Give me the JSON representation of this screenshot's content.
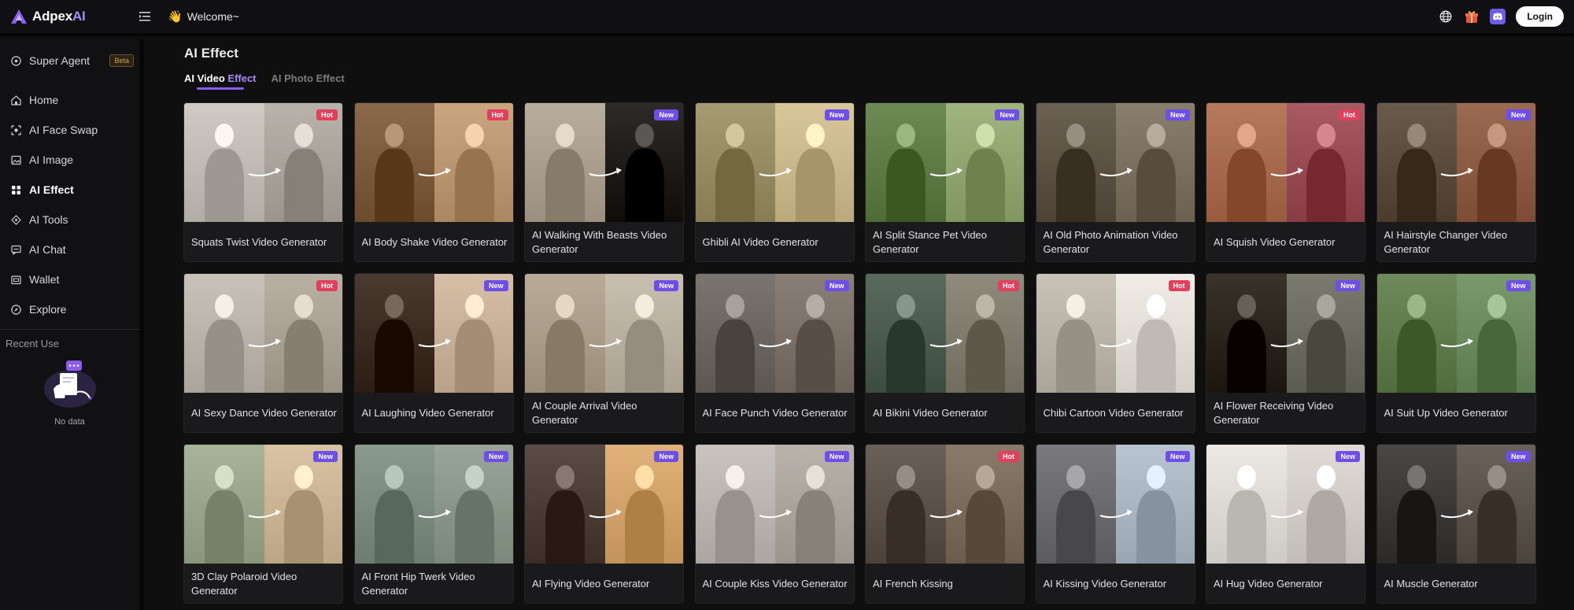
{
  "header": {
    "logo_prefix": "Adpex",
    "logo_suffix": "AI",
    "welcome_emoji": "👋",
    "welcome": "Welcome~",
    "login_label": "Login"
  },
  "sidebar": {
    "items": [
      {
        "label": "Super Agent",
        "icon": "agent-icon",
        "badge": "Beta",
        "active": false
      },
      {
        "label": "Home",
        "icon": "home-icon",
        "active": false
      },
      {
        "label": "AI Face Swap",
        "icon": "face-swap-icon",
        "active": false
      },
      {
        "label": "AI Image",
        "icon": "image-icon",
        "active": false
      },
      {
        "label": "AI Effect",
        "icon": "effect-icon",
        "active": true
      },
      {
        "label": "AI Tools",
        "icon": "tools-icon",
        "active": false
      },
      {
        "label": "AI Chat",
        "icon": "chat-icon",
        "active": false
      },
      {
        "label": "Wallet",
        "icon": "wallet-icon",
        "active": false
      },
      {
        "label": "Explore",
        "icon": "explore-icon",
        "active": false
      }
    ],
    "recent_title": "Recent Use",
    "empty_text": "No data"
  },
  "main": {
    "title": "AI Effect",
    "tabs": [
      {
        "prefix": "AI Video",
        "highlight": " Effect",
        "active": true
      },
      {
        "prefix": "AI Photo Effect",
        "highlight": "",
        "active": false
      }
    ]
  },
  "cards": [
    {
      "title": "Squats Twist Video Generator",
      "badge": "Hot",
      "colors": [
        "#cfcac4",
        "#b8b2ab"
      ]
    },
    {
      "title": "AI Body Shake Video Generator",
      "badge": "Hot",
      "colors": [
        "#8a6a4a",
        "#c9a680"
      ]
    },
    {
      "title": "AI Walking With Beasts Video Generator",
      "badge": "New",
      "colors": [
        "#b9ad9c",
        "#2d2a28"
      ]
    },
    {
      "title": "Ghibli AI Video Generator",
      "badge": "New",
      "colors": [
        "#a69a72",
        "#d8c79a"
      ]
    },
    {
      "title": "AI Split Stance Pet Video Generator",
      "badge": "New",
      "colors": [
        "#6d8a55",
        "#9fb47e"
      ]
    },
    {
      "title": "AI Old Photo Animation Video Generator",
      "badge": "New",
      "colors": [
        "#6b6152",
        "#8a7f6d"
      ]
    },
    {
      "title": "AI Squish Video Generator",
      "badge": "Hot",
      "colors": [
        "#b6795e",
        "#a85a62"
      ]
    },
    {
      "title": "AI Hairstyle Changer Video Generator",
      "badge": "New",
      "colors": [
        "#6a5a4c",
        "#9a6a52"
      ]
    },
    {
      "title": "AI Sexy Dance Video Generator",
      "badge": "Hot",
      "colors": [
        "#c8c2b9",
        "#b9b0a4"
      ]
    },
    {
      "title": "AI Laughing Video Generator",
      "badge": "New",
      "colors": [
        "#4a3a30",
        "#d6bfa6"
      ]
    },
    {
      "title": "AI Couple Arrival Video Generator",
      "badge": "New",
      "colors": [
        "#b9ab98",
        "#c9bfb0"
      ]
    },
    {
      "title": "AI Face Punch Video Generator",
      "badge": "New",
      "colors": [
        "#7a7570",
        "#8a8078"
      ]
    },
    {
      "title": "AI Bikini Video Generator",
      "badge": "Hot",
      "colors": [
        "#5a6a5c",
        "#8e8a7c"
      ]
    },
    {
      "title": "Chibi Cartoon Video Generator",
      "badge": "Hot",
      "colors": [
        "#c9c2b6",
        "#f1ece6"
      ]
    },
    {
      "title": "AI Flower Receiving Video Generator",
      "badge": "New",
      "colors": [
        "#3a332c",
        "#7a7a6e"
      ]
    },
    {
      "title": "AI Suit Up Video Generator",
      "badge": "New",
      "colors": [
        "#6f8a5a",
        "#7a9a6e"
      ]
    },
    {
      "title": "3D Clay Polaroid Video Generator",
      "badge": "New",
      "colors": [
        "#a8b49a",
        "#d9c3a3"
      ]
    },
    {
      "title": "AI Front Hip Twerk Video Generator",
      "badge": "New",
      "colors": [
        "#8a9a8c",
        "#98a598"
      ]
    },
    {
      "title": "AI Flying Video Generator",
      "badge": "New",
      "colors": [
        "#5a4c44",
        "#e0b27a"
      ]
    },
    {
      "title": "AI Couple Kiss Video Generator",
      "badge": "New",
      "colors": [
        "#c9c4bf",
        "#b9b3ac"
      ]
    },
    {
      "title": "AI French Kissing",
      "badge": "Hot",
      "colors": [
        "#6a6058",
        "#8a7a6c"
      ]
    },
    {
      "title": "AI Kissing Video Generator",
      "badge": "New",
      "colors": [
        "#7a7a7e",
        "#b8c4d0"
      ]
    },
    {
      "title": "AI Hug Video Generator",
      "badge": "New",
      "colors": [
        "#ece8e4",
        "#e0dbd6"
      ]
    },
    {
      "title": "AI Muscle Generator",
      "badge": "New",
      "colors": [
        "#4a4846",
        "#6a625a"
      ]
    }
  ]
}
